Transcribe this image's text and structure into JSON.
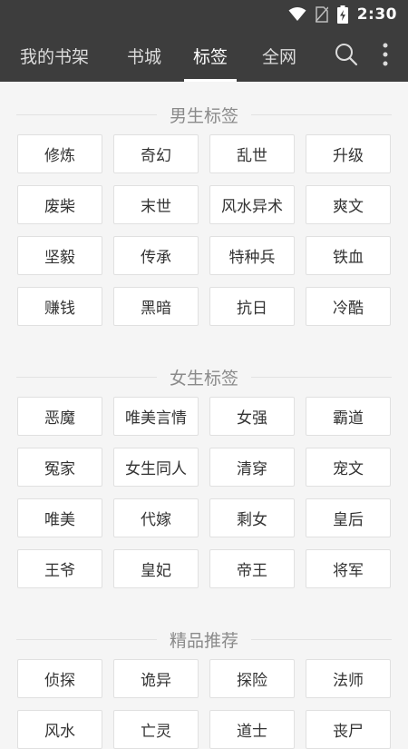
{
  "status_bar": {
    "time": "2:30",
    "icons": [
      "wifi-icon",
      "no-sim-icon",
      "battery-charging-icon"
    ]
  },
  "nav": {
    "tabs": [
      {
        "label": "我的书架",
        "active": false
      },
      {
        "label": "书城",
        "active": false
      },
      {
        "label": "标签",
        "active": true
      },
      {
        "label": "全网",
        "active": false
      }
    ],
    "icons": [
      "search-icon",
      "more-vertical-icon"
    ]
  },
  "sections": [
    {
      "title": "男生标签",
      "tags": [
        "修炼",
        "奇幻",
        "乱世",
        "升级",
        "废柴",
        "末世",
        "风水异术",
        "爽文",
        "坚毅",
        "传承",
        "特种兵",
        "铁血",
        "赚钱",
        "黑暗",
        "抗日",
        "冷酷"
      ]
    },
    {
      "title": "女生标签",
      "tags": [
        "恶魔",
        "唯美言情",
        "女强",
        "霸道",
        "冤家",
        "女生同人",
        "清穿",
        "宠文",
        "唯美",
        "代嫁",
        "剩女",
        "皇后",
        "王爷",
        "皇妃",
        "帝王",
        "将军"
      ]
    },
    {
      "title": "精品推荐",
      "tags": [
        "侦探",
        "诡异",
        "探险",
        "法师",
        "风水",
        "亡灵",
        "道士",
        "丧尸"
      ]
    }
  ],
  "colors": {
    "bar": "#3d3d3d",
    "background": "#f5f5f5",
    "tag_border": "#e0e0e0",
    "section_title": "#8a8a8a"
  }
}
